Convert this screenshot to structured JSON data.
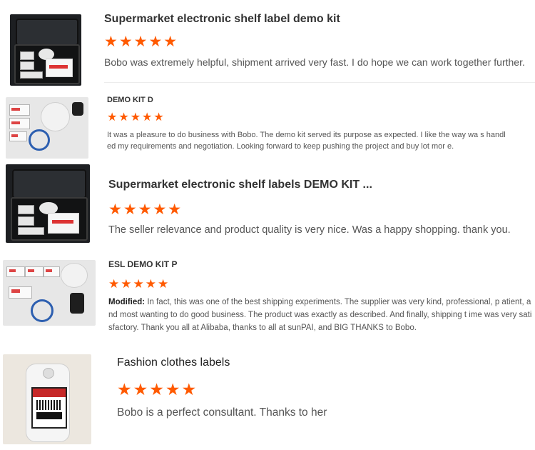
{
  "reviews": [
    {
      "title": "Supermarket electronic shelf label demo kit",
      "stars": "★★★★★",
      "rating": 5,
      "thumbnail": "esl-demo-kit-case-photo",
      "body": "Bobo was extremely helpful, shipment arrived very fast. I do hope we can work together further."
    },
    {
      "title": "DEMO KIT D",
      "stars": "★★★★★",
      "rating": 5,
      "thumbnail": "esl-demo-kit-contents-photo",
      "body": "It was a pleasure to do business with Bobo. The demo kit served its purpose as expected. I like the way wa s handled my requirements and negotiation. Looking forward to keep pushing the project and buy lot mor e."
    },
    {
      "title": "Supermarket electronic shelf labels DEMO KIT ...",
      "stars": "★★★★★",
      "rating": 5,
      "thumbnail": "esl-demo-kit-case-photo",
      "body": "The seller relevance and product quality is very nice. Was a happy shopping. thank you."
    },
    {
      "title": "ESL DEMO KIT P",
      "stars": "★★★★★",
      "rating": 5,
      "thumbnail": "esl-demo-kit-contents-photo",
      "body_prefix": "Modified:",
      "body": "In fact, this was one of the best shipping experiments. The supplier was very kind, professional, p atient, and most wanting to do good business. The product was exactly as described. And finally, shipping t ime was very satisfactory. Thank you all at Alibaba, thanks to all at sunPAI, and BIG THANKS to Bobo."
    },
    {
      "title": "Fashion clothes labels",
      "stars": "★★★★★",
      "rating": 5,
      "thumbnail": "fashion-clothes-label-photo",
      "body": "Bobo is a perfect consultant. Thanks to her"
    }
  ],
  "colors": {
    "star": "#ff5a00",
    "title": "#333333",
    "body": "#555555"
  }
}
